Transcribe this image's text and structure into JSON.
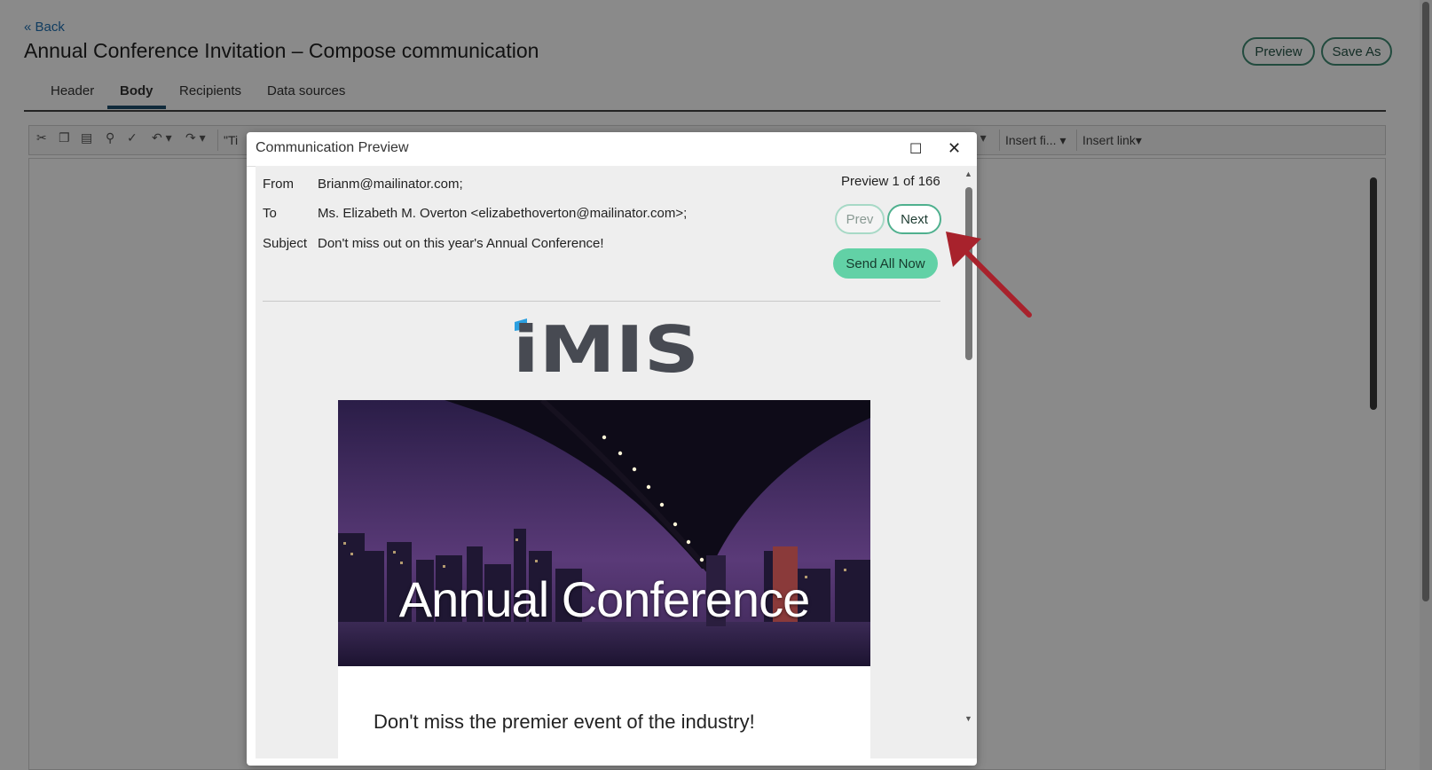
{
  "header": {
    "back_link": "« Back",
    "title": "Annual Conference Invitation – Compose communication",
    "preview_button": "Preview",
    "save_as_button": "Save As"
  },
  "tabs": [
    {
      "label": "Header"
    },
    {
      "label": "Body"
    },
    {
      "label": "Recipients"
    },
    {
      "label": "Data sources"
    }
  ],
  "toolbar": {
    "style_dropdown": "\"Ti",
    "insert_field": "Insert fi...",
    "insert_link": "Insert link"
  },
  "modal": {
    "title": "Communication Preview",
    "from_label": "From",
    "from_value": "Brianm@mailinator.com;",
    "to_label": "To",
    "to_value": "Ms. Elizabeth M. Overton <elizabethoverton@mailinator.com>;",
    "subject_label": "Subject",
    "subject_value": "Don't miss out on this year's Annual Conference!",
    "counter": "Preview 1 of 166",
    "prev_button": "Prev",
    "next_button": "Next",
    "send_button": "Send All Now",
    "logo_text": "iMIS",
    "hero_text": "Annual Conference",
    "tagline": "Don't miss the premier event of the industry!"
  },
  "colors": {
    "accent_green": "#62d1a6",
    "button_border": "#3f8b74",
    "annotation_arrow": "#a8222c",
    "logo_gray": "#474a52",
    "logo_blue": "#2b9fe0"
  }
}
